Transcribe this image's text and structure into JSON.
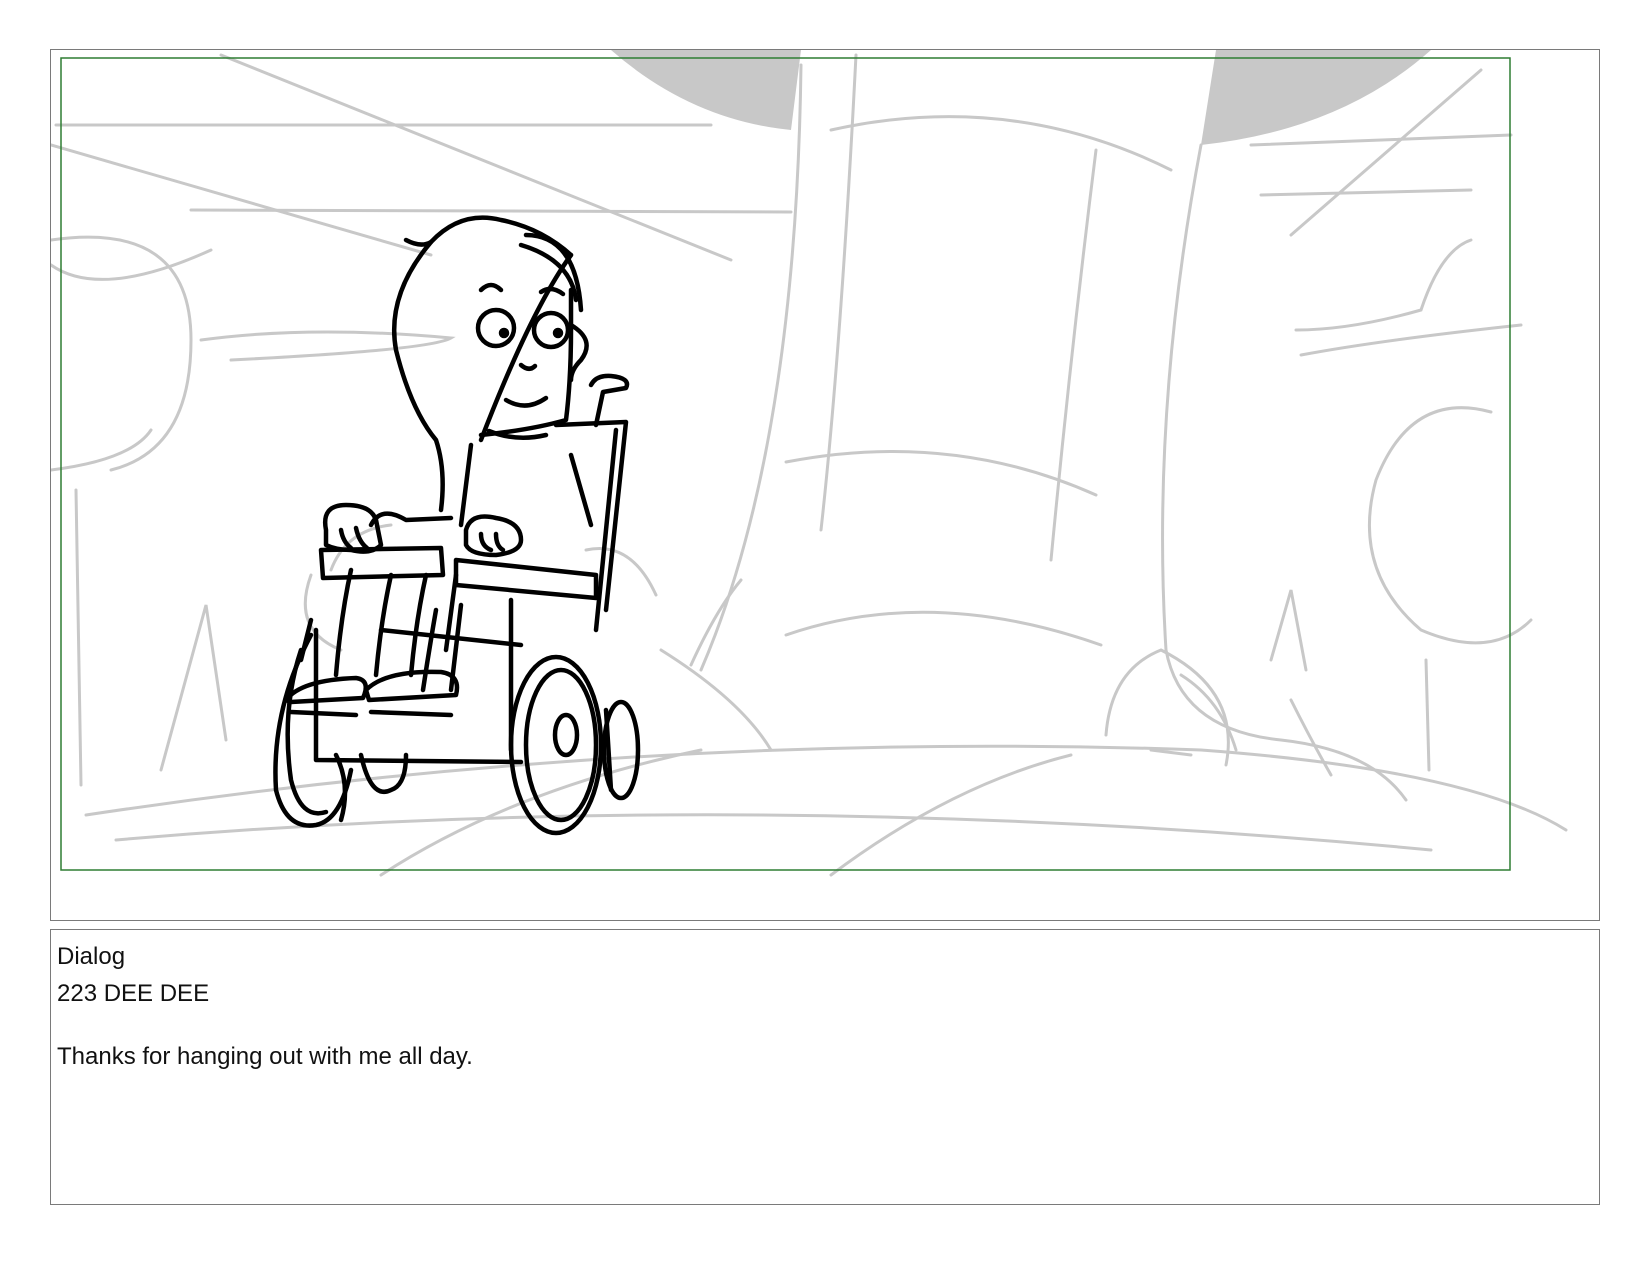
{
  "panel": {
    "safe_frame_color": "#2e7d32",
    "background_line_color": "#c8c8c8",
    "character_line_color": "#000000"
  },
  "dialog": {
    "heading": "Dialog",
    "speaker": "223 DEE DEE",
    "line": "Thanks for hanging out with me all day."
  }
}
